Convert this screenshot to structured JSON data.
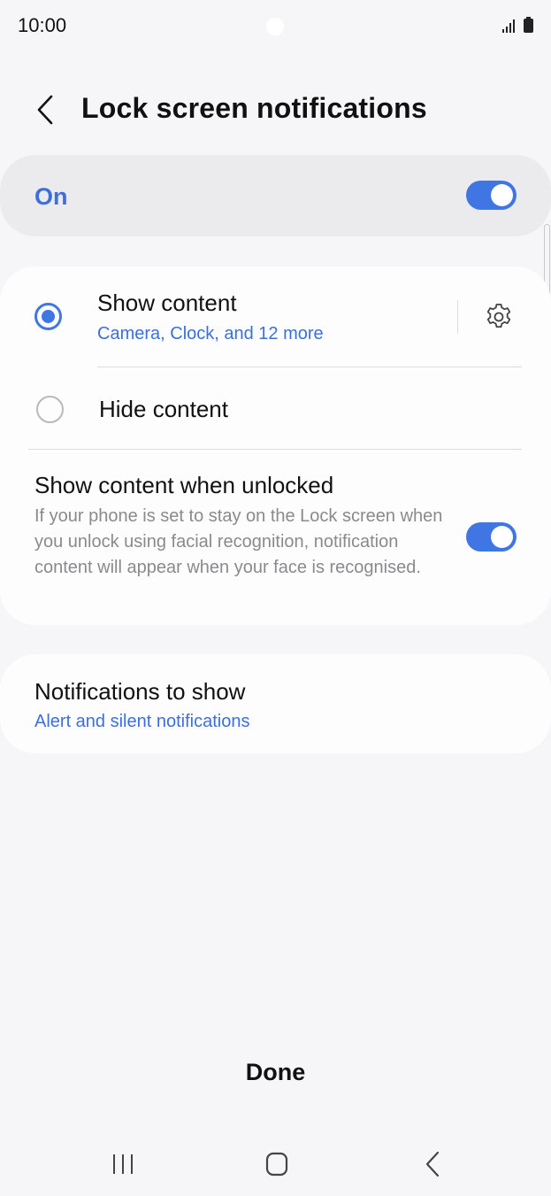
{
  "status_bar": {
    "time": "10:00"
  },
  "header": {
    "title": "Lock screen notifications"
  },
  "master_toggle": {
    "label": "On",
    "enabled": true
  },
  "content_options": {
    "show_content": {
      "title": "Show content",
      "subtitle": "Camera, Clock, and 12 more",
      "selected": true
    },
    "hide_content": {
      "title": "Hide content",
      "selected": false
    },
    "show_when_unlocked": {
      "title": "Show content when unlocked",
      "description": "If your phone is set to stay on the Lock screen when you unlock using facial recognition, notification content will appear when your face is recognised.",
      "enabled": true
    }
  },
  "notifications_to_show": {
    "title": "Notifications to show",
    "value": "Alert and silent notifications"
  },
  "footer": {
    "done_label": "Done"
  },
  "colors": {
    "accent": "#3f76e4",
    "link_text": "#3c6fd9",
    "background": "#f6f6f8",
    "card": "#fdfdfe"
  },
  "icons": [
    "back-icon",
    "gear-icon",
    "signal-icon",
    "battery-icon",
    "recents-icon",
    "home-icon",
    "nav-back-icon"
  ]
}
